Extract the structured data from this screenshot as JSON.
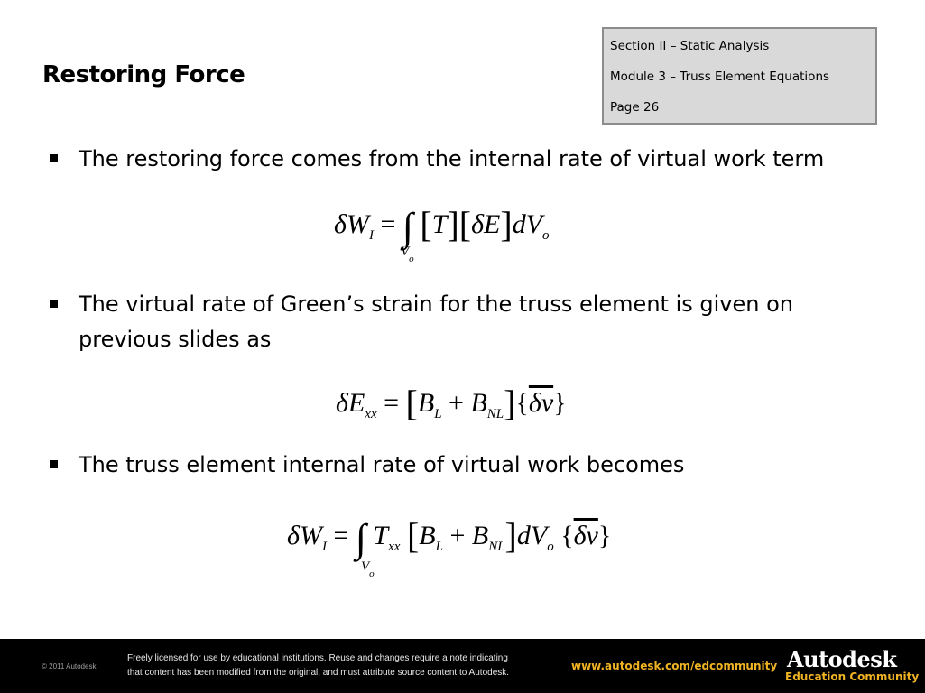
{
  "slide": {
    "title": "Restoring Force",
    "info_box": {
      "section": "Section II – Static Analysis",
      "module": "Module 3 – Truss Element Equations",
      "page": "Page 26"
    },
    "bullets": [
      {
        "text": "The restoring force comes from the internal rate of virtual work term"
      },
      {
        "text": "The virtual rate of Green’s strain for the truss element is given on previous slides as"
      },
      {
        "text": "The truss element internal rate of virtual work becomes"
      }
    ],
    "equations": [
      {
        "lhs": "δW",
        "lhs_sub": "I",
        "eq": "=",
        "int": "∫",
        "lower": "V",
        "lower_sub": "o",
        "body1": "T",
        "body2": "δE",
        "tail": "dV",
        "tail_sub": "o"
      },
      {
        "lhs": "δE",
        "lhs_sub": "xx",
        "eq": "=",
        "b1": "B",
        "b1_sub": "L",
        "plus": "+",
        "b2": "B",
        "b2_sub": "NL",
        "vec": "δv"
      },
      {
        "lhs": "δW",
        "lhs_sub": "I",
        "eq": "=",
        "int": "∫",
        "lower": "V",
        "lower_sub": "o",
        "t": "T",
        "t_sub": "xx",
        "b1": "B",
        "b1_sub": "L",
        "plus": "+",
        "b2": "B",
        "b2_sub": "NL",
        "tail": "dV",
        "tail_sub": "o",
        "vec": "δv"
      }
    ]
  },
  "footer": {
    "copyright": "© 2011 Autodesk",
    "license_line1": "Freely licensed for use by educational institutions. Reuse and changes require a note indicating",
    "license_line2": "that content has been modified from the original, and must attribute source content to Autodesk.",
    "url": "www.autodesk.com/edcommunity",
    "brand": "Autodesk",
    "brand_sub": "Education Community",
    "accent_color": "#f0b323"
  }
}
